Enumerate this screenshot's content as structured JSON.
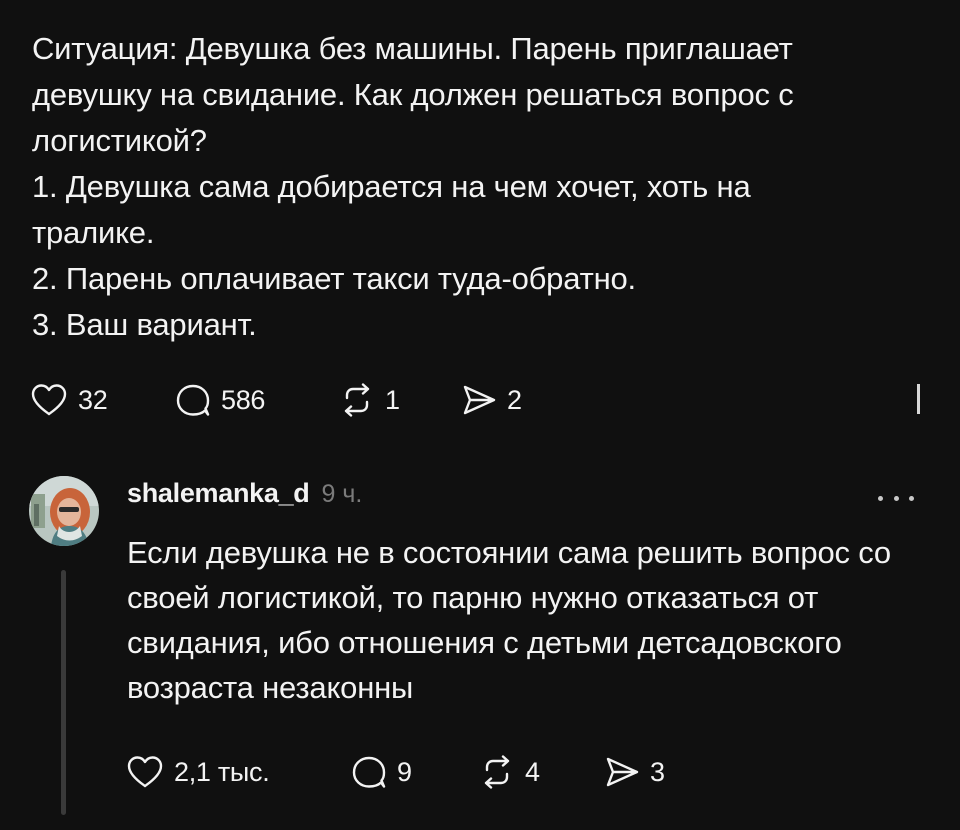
{
  "post": {
    "lines": [
      "Ситуация: Девушка без машины. Парень приглашает",
      "девушку на свидание. Как должен решаться вопрос с",
      "логистикой?",
      "1. Девушка сама добирается на чем хочет, хоть на",
      "тралике.",
      "2. Парень оплачивает такси туда-обратно.",
      "3. Ваш вариант."
    ],
    "stats": {
      "likes": "32",
      "comments": "586",
      "reposts": "1",
      "shares": "2"
    }
  },
  "reply": {
    "username": "shalemanka_d",
    "time": "9 ч.",
    "lines": [
      "Если девушка не в состоянии сама решить вопрос со",
      "своей логистикой, то парню нужно отказаться от",
      "свидания, ибо отношения с детьми детсадовского",
      "возраста незаконны"
    ],
    "stats": {
      "likes": "2,1 тыс.",
      "comments": "9",
      "reposts": "4",
      "shares": "3"
    }
  },
  "icons": {
    "like": "heart-icon",
    "comment": "speech-bubble-icon",
    "repost": "repost-arrows-icon",
    "share": "send-icon",
    "more": "ellipsis-icon"
  },
  "colors": {
    "background": "#101010",
    "text": "#f3f3f3",
    "muted": "#7b7b7b",
    "thread_line": "#3a3a3a"
  }
}
